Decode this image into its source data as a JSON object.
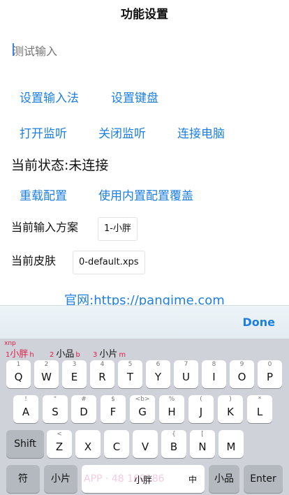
{
  "header": {
    "title": "功能设置"
  },
  "test_input": {
    "placeholder": "测试输入"
  },
  "actions_row1": [
    "设置输入法",
    "设置键盘"
  ],
  "actions_row2": [
    "打开监听",
    "关闭监听",
    "连接电脑"
  ],
  "status": {
    "text": "当前状态:未连接"
  },
  "actions_row3": [
    "重载配置",
    "使用内置配置覆盖"
  ],
  "scheme": {
    "label": "当前输入方案",
    "value": "1-小胖"
  },
  "skin": {
    "label": "当前皮肤",
    "value": "0-default.xps"
  },
  "website": {
    "text": "官网:https://pangime.com"
  },
  "toolbar": {
    "done_label": "Done"
  },
  "keyboard": {
    "preedit": "xnp",
    "candidates": [
      {
        "index": "1",
        "text": "小胖",
        "comment": "h"
      },
      {
        "index": "2",
        "text": "小品",
        "comment": "b"
      },
      {
        "index": "3",
        "text": "小片",
        "comment": "m"
      }
    ],
    "row1": [
      {
        "sub": "1",
        "main": "Q"
      },
      {
        "sub": "2",
        "main": "W"
      },
      {
        "sub": "3",
        "main": "E"
      },
      {
        "sub": "4",
        "main": "R"
      },
      {
        "sub": "5",
        "main": "T"
      },
      {
        "sub": "6",
        "main": "Y"
      },
      {
        "sub": "7",
        "main": "U"
      },
      {
        "sub": "8",
        "main": "I"
      },
      {
        "sub": "9",
        "main": "O"
      },
      {
        "sub": "0",
        "main": "P"
      }
    ],
    "row2": [
      {
        "sub": "!",
        "main": "A"
      },
      {
        "sub": "\"",
        "main": "S"
      },
      {
        "sub": "#",
        "main": "D"
      },
      {
        "sub": "$",
        "main": "F"
      },
      {
        "sub": "<b>",
        "main": "G"
      },
      {
        "sub": "%",
        "main": "H"
      },
      {
        "sub": "(",
        "main": "J"
      },
      {
        "sub": ")",
        "main": "K"
      },
      {
        "sub": "*",
        "main": "L"
      }
    ],
    "row3": [
      {
        "sub": "<",
        "main": "Z"
      },
      {
        "sub": "",
        "main": "X"
      },
      {
        "sub": "",
        "main": "C"
      },
      {
        "sub": "",
        "main": "V"
      },
      {
        "sub": "{",
        "main": "B"
      },
      {
        "sub": "[",
        "main": "N"
      },
      {
        "sub": "",
        "main": "M"
      }
    ],
    "shift_label": "Shift",
    "symbol_label": "符",
    "left_cand": "小片",
    "space_label": "小胖",
    "lang_label": "中",
    "right_cand": "小品",
    "enter_label": "Enter",
    "watermark": "APP · 48 169186"
  },
  "colors": {
    "link": "#1d7fe0",
    "keyboard_bg": "#cfd3d9",
    "candidate_highlight": "#e11d48"
  }
}
